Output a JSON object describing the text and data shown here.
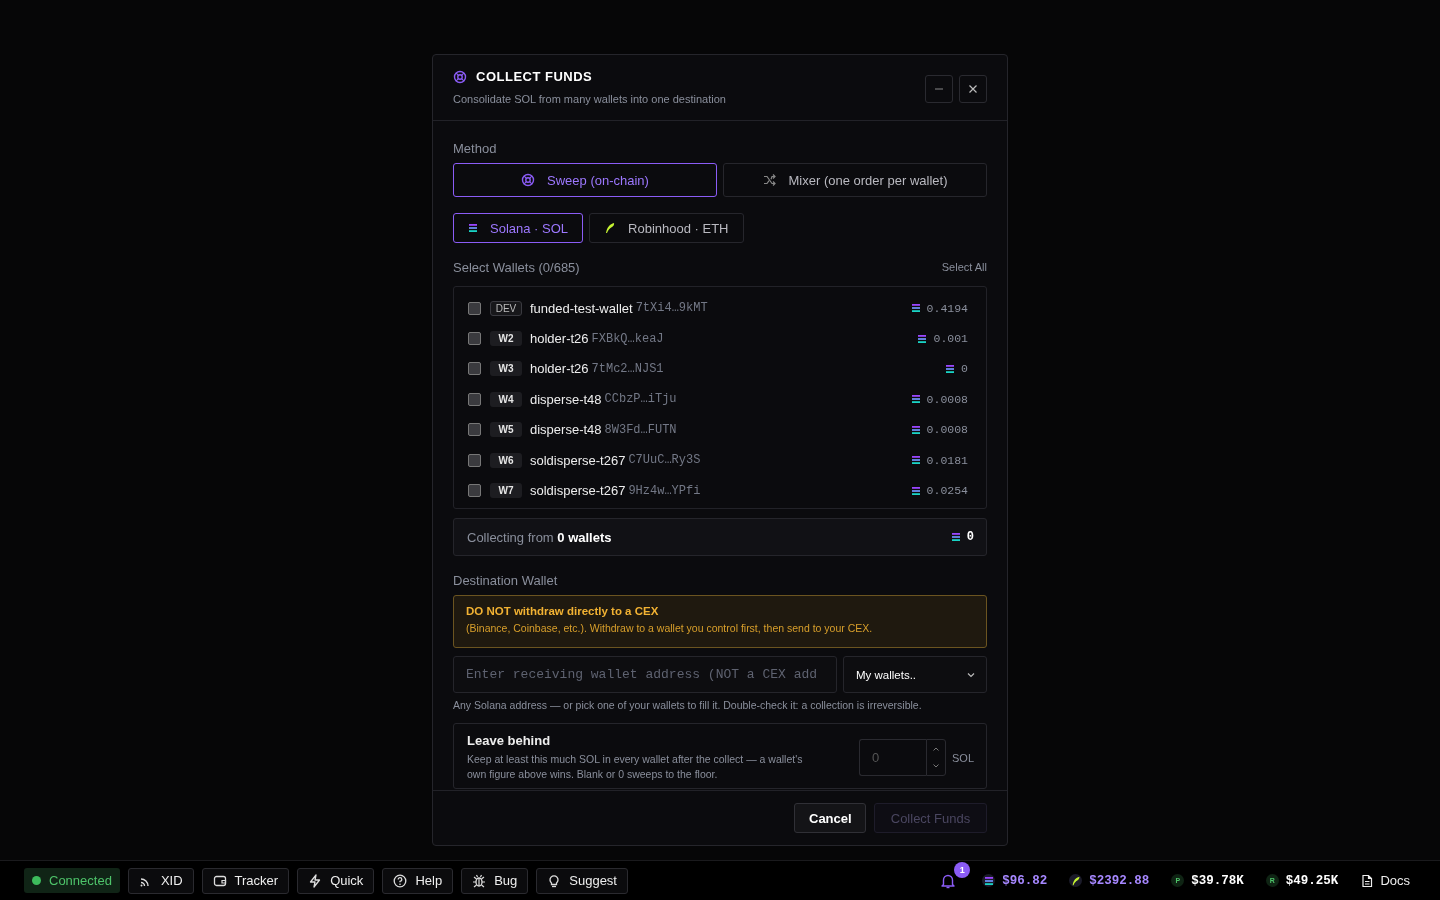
{
  "dialog": {
    "title": "COLLECT FUNDS",
    "subtitle": "Consolidate SOL from many wallets into one destination",
    "method": {
      "label": "Method",
      "options": [
        {
          "kind": "sweep",
          "label": "Sweep (on-chain)",
          "selected": true
        },
        {
          "kind": "mixer",
          "label": "Mixer (one order per wallet)",
          "selected": false
        }
      ]
    },
    "chains": [
      {
        "kind": "sol",
        "label": "Solana · SOL",
        "selected": true
      },
      {
        "kind": "eth",
        "label": "Robinhood · ETH",
        "selected": false
      }
    ],
    "wallets": {
      "label": "Select Wallets (0/685)",
      "select_all": "Select All",
      "items": [
        {
          "tag": "DEV",
          "kind": "dev",
          "name": "funded-test-wallet",
          "address": "7tXi4…9kMT",
          "balance": "0.4194",
          "checked": false
        },
        {
          "tag": "W2",
          "kind": "index",
          "name": "holder-t26",
          "address": "FXBkQ…keaJ",
          "balance": "0.001",
          "checked": false
        },
        {
          "tag": "W3",
          "kind": "index",
          "name": "holder-t26",
          "address": "7tMc2…NJS1",
          "balance": "0",
          "checked": false
        },
        {
          "tag": "W4",
          "kind": "index",
          "name": "disperse-t48",
          "address": "CCbzP…iTju",
          "balance": "0.0008",
          "checked": false
        },
        {
          "tag": "W5",
          "kind": "index",
          "name": "disperse-t48",
          "address": "8W3Fd…FUTN",
          "balance": "0.0008",
          "checked": false
        },
        {
          "tag": "W6",
          "kind": "index",
          "name": "soldisperse-t267",
          "address": "C7UuC…Ry3S",
          "balance": "0.0181",
          "checked": false
        },
        {
          "tag": "W7",
          "kind": "index",
          "name": "soldisperse-t267",
          "address": "9Hz4w…YPfi",
          "balance": "0.0254",
          "checked": false
        }
      ]
    },
    "summary": {
      "text": "Collecting from **0 wallets**",
      "total": "0"
    },
    "destination": {
      "label": "Destination Wallet",
      "warning_title": "DO NOT withdraw directly to a CEX",
      "warning_text": "(Binance, Coinbase, etc.). Withdraw to a wallet you control first, then send to your CEX.",
      "placeholder": "Enter receiving wallet address (NOT a CEX add",
      "picker": "My wallets..",
      "hint": "Any Solana address — or pick one of your wallets to fill it. Double-check it: a collection is irreversible."
    },
    "leave_behind": {
      "title": "Leave behind",
      "text": "Keep at least this much SOL in every wallet after the collect — a wallet's own figure above wins. Blank or 0 sweeps to the floor.",
      "placeholder": "0",
      "unit": "SOL"
    },
    "buttons": [
      {
        "kind": "cancel",
        "label": "Cancel",
        "disabled": false
      },
      {
        "kind": "primary",
        "label": "Collect Funds",
        "disabled": true
      }
    ]
  },
  "status_bar": {
    "left": [
      {
        "kind": "status",
        "label": "Connected",
        "on": true
      },
      {
        "kind": "rss",
        "label": "XID"
      },
      {
        "kind": "wallet",
        "label": "Tracker"
      },
      {
        "kind": "bolt",
        "label": "Quick"
      },
      {
        "kind": "help",
        "label": "Help"
      },
      {
        "kind": "bug",
        "label": "Bug"
      },
      {
        "kind": "bulb",
        "label": "Suggest"
      }
    ],
    "notifications": "1",
    "prices": [
      {
        "kind": "sol",
        "value": "$96.82",
        "highlight": true
      },
      {
        "kind": "eth",
        "value": "$2392.88",
        "highlight": true
      },
      {
        "kind": "letter",
        "letter": "P",
        "value": "$39.78K",
        "highlight": false
      },
      {
        "kind": "letter",
        "letter": "R",
        "value": "$49.25K",
        "highlight": false
      }
    ],
    "docs": "Docs"
  }
}
